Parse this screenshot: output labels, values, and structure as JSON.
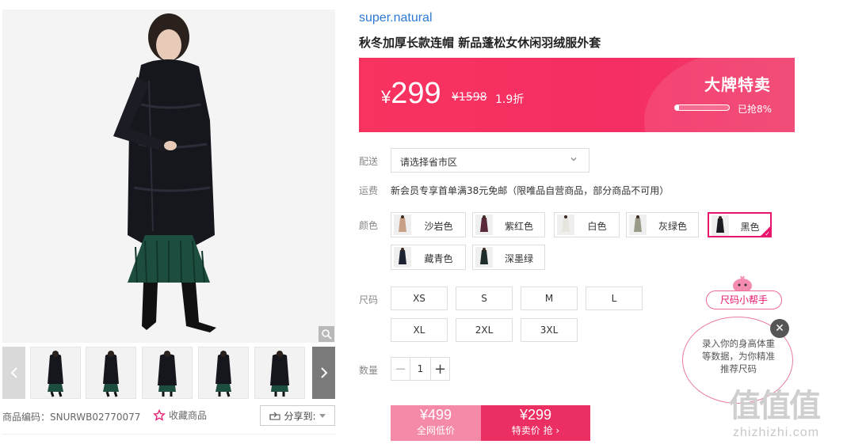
{
  "product": {
    "brand": "super.natural",
    "title": "秋冬加厚长款连帽 新品蓬松女休闲羽绒服外套"
  },
  "price_banner": {
    "currency": "¥",
    "price": "299",
    "original_price": "¥1598",
    "discount": "1.9折",
    "sale_title": "大牌特卖",
    "progress_label": "已抢8%",
    "progress_fraction": 0.08
  },
  "delivery": {
    "label": "配送",
    "region_placeholder": "请选择省市区"
  },
  "freight": {
    "label": "运费",
    "text": "新会员专享首单满38元免邮（限唯品自营商品，部分商品不可用）"
  },
  "colors": {
    "label": "颜色",
    "options": [
      {
        "name": "沙岩色",
        "swatch": "#c9a086"
      },
      {
        "name": "紫红色",
        "swatch": "#5a2a3a"
      },
      {
        "name": "白色",
        "swatch": "#e8e4de"
      },
      {
        "name": "灰绿色",
        "swatch": "#9a9a88"
      },
      {
        "name": "黑色",
        "swatch": "#1b1b22"
      },
      {
        "name": "藏青色",
        "swatch": "#1d2233"
      },
      {
        "name": "深墨绿",
        "swatch": "#1f2d2a"
      }
    ],
    "selected": "黑色"
  },
  "sizes": {
    "label": "尺码",
    "options": [
      "XS",
      "S",
      "M",
      "L",
      "XL",
      "2XL",
      "3XL"
    ]
  },
  "quantity": {
    "label": "数量",
    "value": "1",
    "minus": "−",
    "plus": "+"
  },
  "buy": {
    "web_price": "¥499",
    "web_label": "全网低价",
    "sale_price": "¥299",
    "sale_label": "特卖价 抢 ›"
  },
  "meta": {
    "sku": "商品编码：SNURWB02770077",
    "favorite": "收藏商品",
    "share": "分享到:"
  },
  "size_helper": {
    "tag": "尺码小帮手",
    "text": "录入你的身高体重等数据，为你精准推荐尺码"
  },
  "watermark": {
    "logo": "值值值",
    "site": "zhizhizhi.com"
  },
  "colors_theme": {
    "accent": "#ec2f62",
    "brand_link": "#2b7ad6"
  }
}
